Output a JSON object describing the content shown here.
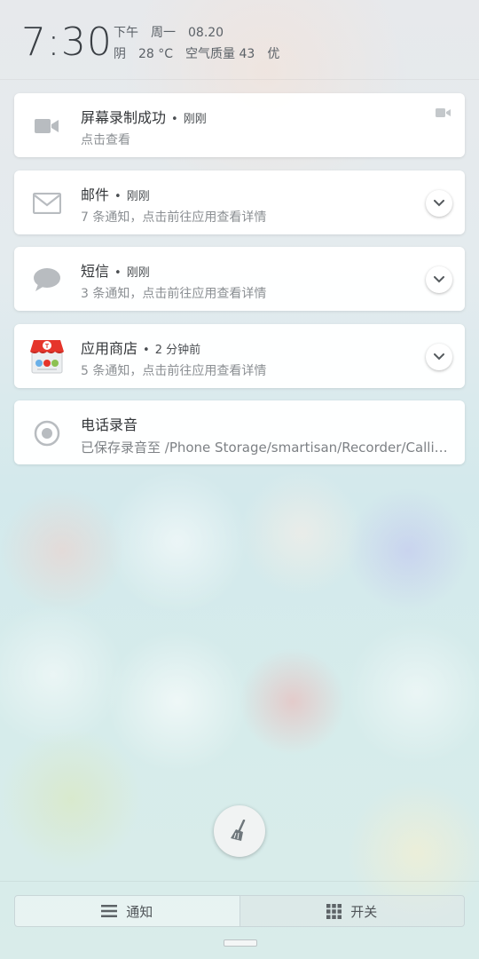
{
  "status": {
    "time": "7:30",
    "ampm": "下午",
    "weekday": "周一",
    "date": "08.20",
    "weather": "阴",
    "temperature": "28 °C",
    "air_quality_label": "空气质量 43",
    "air_quality_level": "优"
  },
  "notifications": [
    {
      "title": "屏幕录制成功",
      "separator": "•",
      "time": "刚刚",
      "text": "点击查看",
      "icon": "video-camera-icon"
    },
    {
      "title": "邮件",
      "separator": "•",
      "time": "刚刚",
      "text": "7 条通知，点击前往应用查看详情",
      "icon": "mail-icon"
    },
    {
      "title": "短信",
      "separator": "•",
      "time": "刚刚",
      "text": "3 条通知，点击前往应用查看详情",
      "icon": "message-bubble-icon"
    },
    {
      "title": "应用商店",
      "separator": "•",
      "time": "2 分钟前",
      "text": "5 条通知，点击前往应用查看详情",
      "icon": "app-store-icon"
    },
    {
      "title": "电话录音",
      "text": "已保存录音至 /Phone Storage/smartisan/Recorder/Calling...",
      "icon": "record-icon"
    }
  ],
  "tabs": [
    {
      "label": "通知",
      "icon": "list-icon"
    },
    {
      "label": "开关",
      "icon": "grid-icon"
    }
  ],
  "colors": {
    "clock": "#3a3f44",
    "title": "#333639",
    "subtitle": "#8b8f93",
    "icon_gray": "#b8bcc0",
    "store_red": "#e5352b"
  }
}
